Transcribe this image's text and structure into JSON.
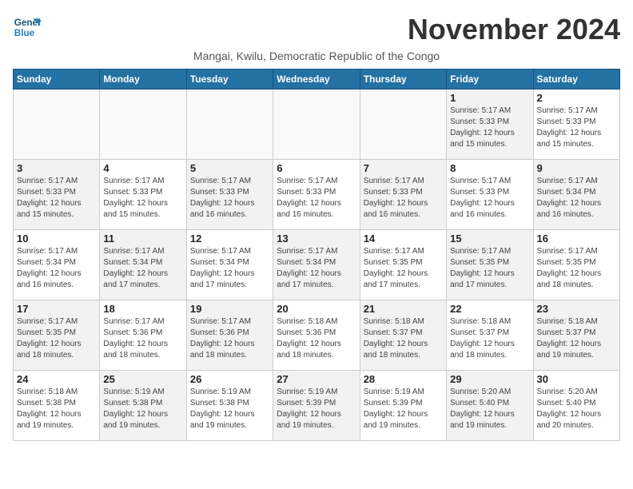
{
  "logo": {
    "line1": "General",
    "line2": "Blue"
  },
  "title": "November 2024",
  "subtitle": "Mangai, Kwilu, Democratic Republic of the Congo",
  "days_of_week": [
    "Sunday",
    "Monday",
    "Tuesday",
    "Wednesday",
    "Thursday",
    "Friday",
    "Saturday"
  ],
  "weeks": [
    [
      {
        "day": "",
        "info": "",
        "empty": true
      },
      {
        "day": "",
        "info": "",
        "empty": true
      },
      {
        "day": "",
        "info": "",
        "empty": true
      },
      {
        "day": "",
        "info": "",
        "empty": true
      },
      {
        "day": "",
        "info": "",
        "empty": true
      },
      {
        "day": "1",
        "info": "Sunrise: 5:17 AM\nSunset: 5:33 PM\nDaylight: 12 hours\nand 15 minutes.",
        "shaded": true
      },
      {
        "day": "2",
        "info": "Sunrise: 5:17 AM\nSunset: 5:33 PM\nDaylight: 12 hours\nand 15 minutes.",
        "shaded": false
      }
    ],
    [
      {
        "day": "3",
        "info": "Sunrise: 5:17 AM\nSunset: 5:33 PM\nDaylight: 12 hours\nand 15 minutes.",
        "shaded": true
      },
      {
        "day": "4",
        "info": "Sunrise: 5:17 AM\nSunset: 5:33 PM\nDaylight: 12 hours\nand 15 minutes.",
        "shaded": false
      },
      {
        "day": "5",
        "info": "Sunrise: 5:17 AM\nSunset: 5:33 PM\nDaylight: 12 hours\nand 16 minutes.",
        "shaded": true
      },
      {
        "day": "6",
        "info": "Sunrise: 5:17 AM\nSunset: 5:33 PM\nDaylight: 12 hours\nand 16 minutes.",
        "shaded": false
      },
      {
        "day": "7",
        "info": "Sunrise: 5:17 AM\nSunset: 5:33 PM\nDaylight: 12 hours\nand 16 minutes.",
        "shaded": true
      },
      {
        "day": "8",
        "info": "Sunrise: 5:17 AM\nSunset: 5:33 PM\nDaylight: 12 hours\nand 16 minutes.",
        "shaded": false
      },
      {
        "day": "9",
        "info": "Sunrise: 5:17 AM\nSunset: 5:34 PM\nDaylight: 12 hours\nand 16 minutes.",
        "shaded": true
      }
    ],
    [
      {
        "day": "10",
        "info": "Sunrise: 5:17 AM\nSunset: 5:34 PM\nDaylight: 12 hours\nand 16 minutes.",
        "shaded": false
      },
      {
        "day": "11",
        "info": "Sunrise: 5:17 AM\nSunset: 5:34 PM\nDaylight: 12 hours\nand 17 minutes.",
        "shaded": true
      },
      {
        "day": "12",
        "info": "Sunrise: 5:17 AM\nSunset: 5:34 PM\nDaylight: 12 hours\nand 17 minutes.",
        "shaded": false
      },
      {
        "day": "13",
        "info": "Sunrise: 5:17 AM\nSunset: 5:34 PM\nDaylight: 12 hours\nand 17 minutes.",
        "shaded": true
      },
      {
        "day": "14",
        "info": "Sunrise: 5:17 AM\nSunset: 5:35 PM\nDaylight: 12 hours\nand 17 minutes.",
        "shaded": false
      },
      {
        "day": "15",
        "info": "Sunrise: 5:17 AM\nSunset: 5:35 PM\nDaylight: 12 hours\nand 17 minutes.",
        "shaded": true
      },
      {
        "day": "16",
        "info": "Sunrise: 5:17 AM\nSunset: 5:35 PM\nDaylight: 12 hours\nand 18 minutes.",
        "shaded": false
      }
    ],
    [
      {
        "day": "17",
        "info": "Sunrise: 5:17 AM\nSunset: 5:35 PM\nDaylight: 12 hours\nand 18 minutes.",
        "shaded": true
      },
      {
        "day": "18",
        "info": "Sunrise: 5:17 AM\nSunset: 5:36 PM\nDaylight: 12 hours\nand 18 minutes.",
        "shaded": false
      },
      {
        "day": "19",
        "info": "Sunrise: 5:17 AM\nSunset: 5:36 PM\nDaylight: 12 hours\nand 18 minutes.",
        "shaded": true
      },
      {
        "day": "20",
        "info": "Sunrise: 5:18 AM\nSunset: 5:36 PM\nDaylight: 12 hours\nand 18 minutes.",
        "shaded": false
      },
      {
        "day": "21",
        "info": "Sunrise: 5:18 AM\nSunset: 5:37 PM\nDaylight: 12 hours\nand 18 minutes.",
        "shaded": true
      },
      {
        "day": "22",
        "info": "Sunrise: 5:18 AM\nSunset: 5:37 PM\nDaylight: 12 hours\nand 18 minutes.",
        "shaded": false
      },
      {
        "day": "23",
        "info": "Sunrise: 5:18 AM\nSunset: 5:37 PM\nDaylight: 12 hours\nand 19 minutes.",
        "shaded": true
      }
    ],
    [
      {
        "day": "24",
        "info": "Sunrise: 5:18 AM\nSunset: 5:38 PM\nDaylight: 12 hours\nand 19 minutes.",
        "shaded": false
      },
      {
        "day": "25",
        "info": "Sunrise: 5:19 AM\nSunset: 5:38 PM\nDaylight: 12 hours\nand 19 minutes.",
        "shaded": true
      },
      {
        "day": "26",
        "info": "Sunrise: 5:19 AM\nSunset: 5:38 PM\nDaylight: 12 hours\nand 19 minutes.",
        "shaded": false
      },
      {
        "day": "27",
        "info": "Sunrise: 5:19 AM\nSunset: 5:39 PM\nDaylight: 12 hours\nand 19 minutes.",
        "shaded": true
      },
      {
        "day": "28",
        "info": "Sunrise: 5:19 AM\nSunset: 5:39 PM\nDaylight: 12 hours\nand 19 minutes.",
        "shaded": false
      },
      {
        "day": "29",
        "info": "Sunrise: 5:20 AM\nSunset: 5:40 PM\nDaylight: 12 hours\nand 19 minutes.",
        "shaded": true
      },
      {
        "day": "30",
        "info": "Sunrise: 5:20 AM\nSunset: 5:40 PM\nDaylight: 12 hours\nand 20 minutes.",
        "shaded": false
      }
    ]
  ]
}
